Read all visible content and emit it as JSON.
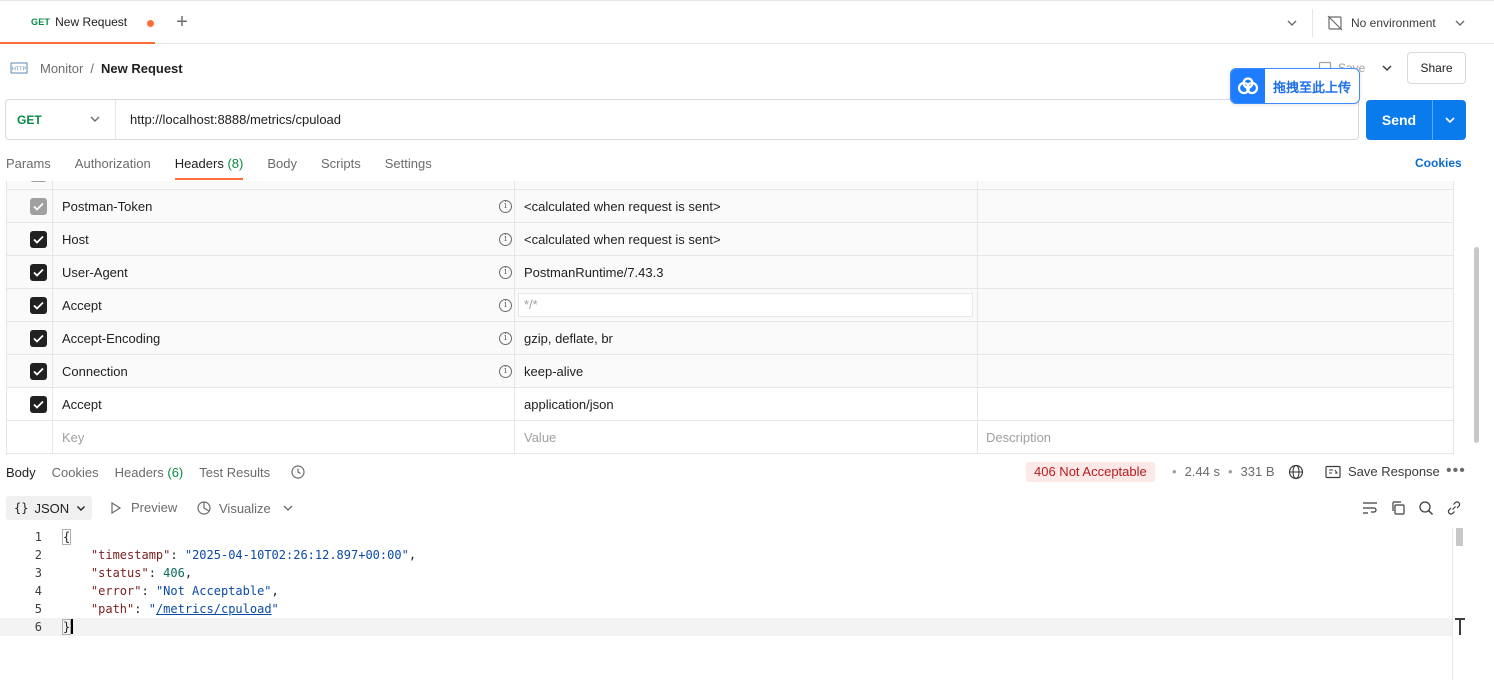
{
  "tabbar": {
    "tab_method": "GET",
    "tab_name": "New Request",
    "environment": "No environment"
  },
  "breadcrumb": {
    "parent": "Monitor",
    "separator": "/",
    "current": "New Request"
  },
  "toolbar": {
    "save_label": "Save",
    "share_label": "Share"
  },
  "upload_overlay": {
    "label": "拖拽至此上传"
  },
  "request": {
    "method": "GET",
    "url": "http://localhost:8888/metrics/cpuload",
    "send_label": "Send"
  },
  "request_tabs": {
    "params": "Params",
    "authorization": "Authorization",
    "headers": "Headers",
    "headers_count": "(8)",
    "body": "Body",
    "scripts": "Scripts",
    "settings": "Settings",
    "cookies": "Cookies"
  },
  "headers": [
    {
      "key": "Postman-Token",
      "value": "<calculated when request is sent>",
      "checked": true,
      "locked": true
    },
    {
      "key": "Host",
      "value": "<calculated when request is sent>",
      "checked": true,
      "locked": false
    },
    {
      "key": "User-Agent",
      "value": "PostmanRuntime/7.43.3",
      "checked": true,
      "locked": false
    },
    {
      "key": "Accept",
      "value": "*/*",
      "checked": true,
      "locked": false
    },
    {
      "key": "Accept-Encoding",
      "value": "gzip, deflate, br",
      "checked": true,
      "locked": false
    },
    {
      "key": "Connection",
      "value": "keep-alive",
      "checked": true,
      "locked": false
    },
    {
      "key": "Accept",
      "value": "application/json",
      "checked": true,
      "locked": false
    }
  ],
  "headers_placeholder": {
    "key": "Key",
    "value": "Value",
    "description": "Description"
  },
  "response_tabs": {
    "body": "Body",
    "cookies": "Cookies",
    "headers": "Headers",
    "headers_count": "(6)",
    "test_results": "Test Results"
  },
  "response_meta": {
    "status": "406 Not Acceptable",
    "time": "2.44 s",
    "size": "331 B",
    "save_response": "Save Response",
    "more": "•••"
  },
  "response_format": {
    "format": "JSON",
    "braces": "{}",
    "preview": "Preview",
    "visualize": "Visualize"
  },
  "response_body": {
    "line_numbers": [
      "1",
      "2",
      "3",
      "4",
      "5",
      "6"
    ],
    "open_brace": "{",
    "close_brace": "}",
    "timestamp_key": "\"timestamp\"",
    "timestamp_value": "\"2025-04-10T02:26:12.897+00:00\"",
    "status_key": "\"status\"",
    "status_value": "406",
    "error_key": "\"error\"",
    "error_value": "\"Not Acceptable\"",
    "path_key": "\"path\"",
    "path_value": "/metrics/cpuload"
  },
  "colors": {
    "accent": "#ff6c37",
    "send": "#097bed",
    "get_method": "#0b8a46",
    "link": "#0a6bd1",
    "error": "#b71c1c"
  }
}
